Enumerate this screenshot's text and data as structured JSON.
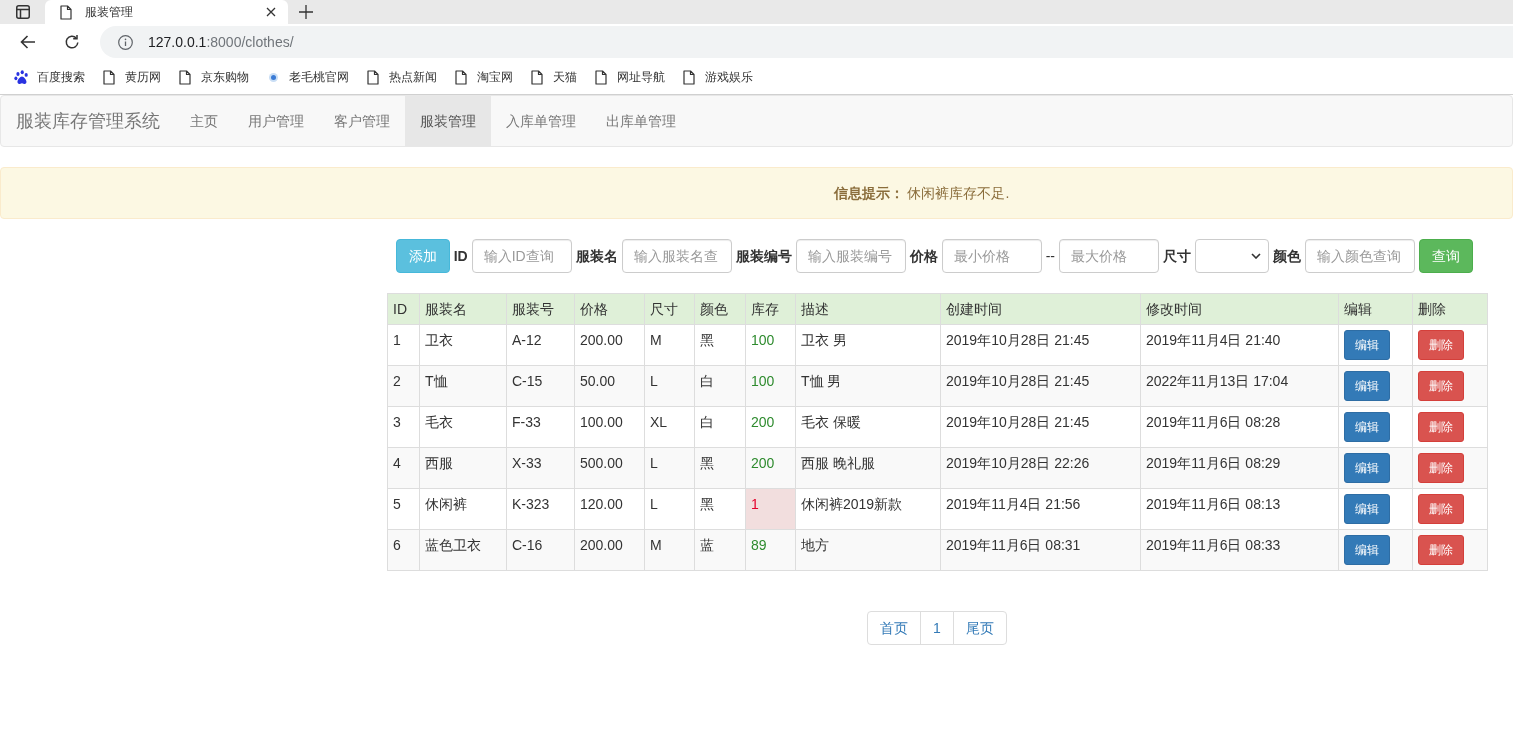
{
  "browser": {
    "tab": {
      "title": "服装管理"
    },
    "address": {
      "host": "127.0.0.1",
      "path": ":8000/clothes/"
    },
    "bookmarks": [
      {
        "label": "百度搜索",
        "kind": "paw"
      },
      {
        "label": "黄历网",
        "kind": "page"
      },
      {
        "label": "京东购物",
        "kind": "page"
      },
      {
        "label": "老毛桃官网",
        "kind": "dot"
      },
      {
        "label": "热点新闻",
        "kind": "page"
      },
      {
        "label": "淘宝网",
        "kind": "page"
      },
      {
        "label": "天猫",
        "kind": "page"
      },
      {
        "label": "网址导航",
        "kind": "page"
      },
      {
        "label": "游戏娱乐",
        "kind": "page"
      }
    ]
  },
  "navbar": {
    "brand": "服装库存管理系统",
    "items": [
      {
        "label": "主页",
        "selected": false
      },
      {
        "label": "用户管理",
        "selected": false
      },
      {
        "label": "客户管理",
        "selected": false
      },
      {
        "label": "服装管理",
        "selected": true
      },
      {
        "label": "入库单管理",
        "selected": false
      },
      {
        "label": "出库单管理",
        "selected": false
      }
    ]
  },
  "alert": {
    "message": "**信息提示：** 休闲裤库存不足."
  },
  "search_form": {
    "items": [
      {
        "kind": "add_button",
        "label": "添加"
      },
      {
        "kind": "label",
        "text": "ID"
      },
      {
        "kind": "input",
        "placeholder": "输入ID查询"
      },
      {
        "kind": "label",
        "text": "服装名"
      },
      {
        "kind": "input",
        "placeholder": "输入服装名查"
      },
      {
        "kind": "label",
        "text": "服装编号"
      },
      {
        "kind": "input",
        "placeholder": "输入服装编号"
      },
      {
        "kind": "label",
        "text": "价格"
      },
      {
        "kind": "input",
        "placeholder": "最小价格"
      },
      {
        "kind": "separator",
        "text": "--"
      },
      {
        "kind": "input",
        "placeholder": "最大价格"
      },
      {
        "kind": "label",
        "text": "尺寸"
      },
      {
        "kind": "select"
      },
      {
        "kind": "label",
        "text": "颜色"
      },
      {
        "kind": "input",
        "placeholder": "输入颜色查询"
      },
      {
        "kind": "query_button",
        "label": "查询"
      }
    ]
  },
  "table": {
    "columns": [
      {
        "label": "ID",
        "kind": "text"
      },
      {
        "label": "服装名",
        "kind": "text"
      },
      {
        "label": "服装号",
        "kind": "text"
      },
      {
        "label": "价格",
        "kind": "text"
      },
      {
        "label": "尺寸",
        "kind": "text"
      },
      {
        "label": "颜色",
        "kind": "text"
      },
      {
        "label": "库存",
        "kind": "stock"
      },
      {
        "label": "描述",
        "kind": "text"
      },
      {
        "label": "创建时间",
        "kind": "text"
      },
      {
        "label": "修改时间",
        "kind": "text"
      },
      {
        "label": "编辑",
        "kind": "edit"
      },
      {
        "label": "删除",
        "kind": "delete"
      }
    ],
    "rows": [
      {
        "low_stock": false,
        "cells": [
          "1",
          "卫衣",
          "A-12",
          "200.00",
          "M",
          "黑",
          "100",
          "卫衣 男",
          "2019年10月28日 21:45",
          "2019年11月4日 21:40",
          "编辑",
          "删除"
        ]
      },
      {
        "low_stock": false,
        "cells": [
          "2",
          "T恤",
          "C-15",
          "50.00",
          "L",
          "白",
          "100",
          "T恤 男",
          "2019年10月28日 21:45",
          "2022年11月13日 17:04",
          "编辑",
          "删除"
        ]
      },
      {
        "low_stock": false,
        "cells": [
          "3",
          "毛衣",
          "F-33",
          "100.00",
          "XL",
          "白",
          "200",
          "毛衣 保暖",
          "2019年10月28日 21:45",
          "2019年11月6日 08:28",
          "编辑",
          "删除"
        ]
      },
      {
        "low_stock": false,
        "cells": [
          "4",
          "西服",
          "X-33",
          "500.00",
          "L",
          "黑",
          "200",
          "西服 晚礼服",
          "2019年10月28日 22:26",
          "2019年11月6日 08:29",
          "编辑",
          "删除"
        ]
      },
      {
        "low_stock": true,
        "cells": [
          "5",
          "休闲裤",
          "K-323",
          "120.00",
          "L",
          "黑",
          "1",
          "休闲裤2019新款",
          "2019年11月4日 21:56",
          "2019年11月6日 08:13",
          "编辑",
          "删除"
        ]
      },
      {
        "low_stock": false,
        "cells": [
          "6",
          "蓝色卫衣",
          "C-16",
          "200.00",
          "M",
          "蓝",
          "89",
          "地方",
          "2019年11月6日 08:31",
          "2019年11月6日 08:33",
          "编辑",
          "删除"
        ]
      }
    ]
  },
  "pagination": [
    {
      "label": "首页"
    },
    {
      "label": "1"
    },
    {
      "label": "尾页"
    }
  ]
}
